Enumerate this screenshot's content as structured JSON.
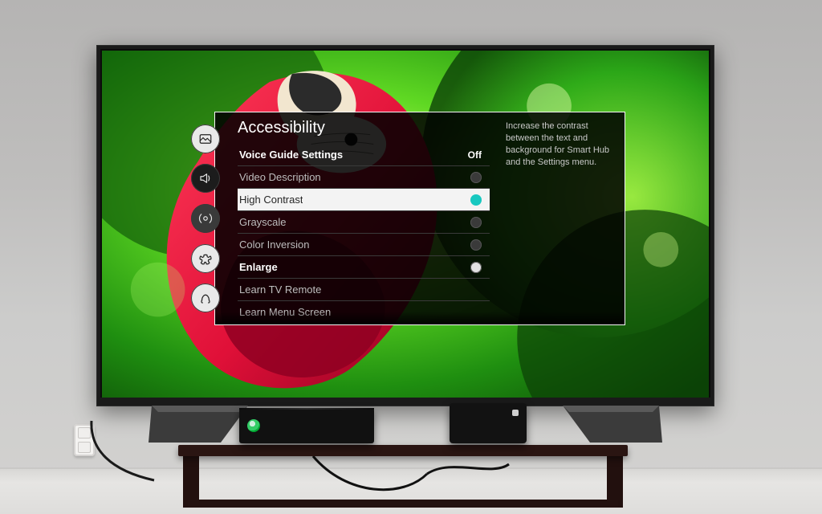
{
  "menu_title": "Accessibility",
  "description": "Increase the contrast between the text and background for Smart Hub and the Settings menu.",
  "rail": [
    {
      "icon": "picture-icon",
      "selected": false,
      "bright": true
    },
    {
      "icon": "sound-icon",
      "selected": false,
      "bright": false
    },
    {
      "icon": "broadcast-icon",
      "selected": true,
      "bright": false
    },
    {
      "icon": "general-icon",
      "selected": false,
      "bright": true
    },
    {
      "icon": "support-icon",
      "selected": false,
      "bright": true
    }
  ],
  "items": [
    {
      "label": "Voice Guide Settings",
      "type": "submenu",
      "value": "Off",
      "strong": true,
      "active": false
    },
    {
      "label": "Video Description",
      "type": "toggle",
      "on": false,
      "active": false
    },
    {
      "label": "High Contrast",
      "type": "toggle",
      "on": true,
      "active": true
    },
    {
      "label": "Grayscale",
      "type": "toggle",
      "on": false,
      "active": false
    },
    {
      "label": "Color Inversion",
      "type": "toggle",
      "on": false,
      "active": false
    },
    {
      "label": "Enlarge",
      "type": "toggle",
      "on": true,
      "light": true,
      "strong": true,
      "active": false
    },
    {
      "label": "Learn TV Remote",
      "type": "submenu",
      "active": false
    },
    {
      "label": "Learn Menu Screen",
      "type": "submenu",
      "active": false
    }
  ]
}
